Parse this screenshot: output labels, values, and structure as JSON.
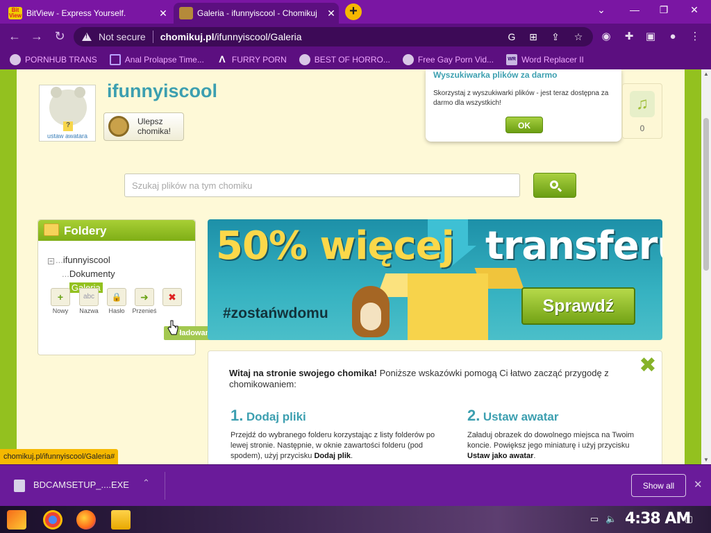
{
  "tabs": [
    {
      "title": "BitView - Express Yourself.",
      "favicon": "bitview-icon",
      "favicon_text": "Bit View",
      "active": false
    },
    {
      "title": "Galeria - ifunnyiscool - Chomikuj",
      "favicon": "chomikuj-icon",
      "favicon_text": "",
      "active": true
    }
  ],
  "new_tab_label": "+",
  "window_controls": {
    "minimize": "⌄",
    "restore": "❐",
    "close": "✕",
    "min2": "—"
  },
  "omnibox": {
    "security": "Not secure",
    "host": "chomikuj.pl",
    "path": "/ifunnyiscool/Galeria"
  },
  "bookmarks": [
    {
      "label": "PORNHUB TRANS",
      "icon": "globe-icon"
    },
    {
      "label": "Anal Prolapse Time...",
      "icon": "bracket-icon"
    },
    {
      "label": "FURRY PORN",
      "icon": "lambda-icon"
    },
    {
      "label": "BEST OF HORRO...",
      "icon": "globe-icon"
    },
    {
      "label": "Free Gay Porn Vid...",
      "icon": "bear-icon"
    },
    {
      "label": "Word Replacer II",
      "icon": "word-replacer-icon"
    }
  ],
  "profile": {
    "username": "ifunnyiscool",
    "set_avatar": "ustaw awatara",
    "upgrade_label_line1": "Ulepsz",
    "upgrade_label_line2": "chomika!",
    "music_count": "0"
  },
  "popup": {
    "title": "Wyszukiwarka plików za darmo",
    "body": "Skorzystaj z wyszukiwarki plików - jest teraz dostępna za darmo dla wszystkich!",
    "ok": "OK"
  },
  "search": {
    "placeholder": "Szukaj plików na tym chomiku"
  },
  "folders": {
    "title": "Foldery",
    "minus": "−",
    "root": "ifunnyiscool",
    "dots": "...",
    "children": [
      "Dokumenty",
      "Galeria"
    ],
    "tools": [
      {
        "label": "Nowy",
        "glyph": "+",
        "color": "#6aa317"
      },
      {
        "label": "Nazwa",
        "glyph": "abc",
        "color": "#9aa"
      },
      {
        "label": "Hasło",
        "glyph": "🔒",
        "color": "#a9a27a"
      },
      {
        "label": "Przenieś",
        "glyph": "➜",
        "color": "#6aa317"
      },
      {
        "label": "",
        "glyph": "✖",
        "color": "#d22"
      }
    ],
    "loading": "ładowanie..."
  },
  "banner": {
    "headline_left": "50% więcej",
    "headline_right": "transferu!",
    "hashtag": "#zostańwdomu",
    "cta": "Sprawdź"
  },
  "welcome": {
    "intro_bold": "Witaj na stronie swojego chomika!",
    "intro_rest": " Poniższe wskazówki pomogą Ci łatwo zacząć przygodę z chomikowaniem:",
    "close_glyph": "✖",
    "steps": [
      {
        "num": "1.",
        "title": "Dodaj pliki",
        "body_pre": "Przejdź do wybranego folderu korzystając z listy folderów po lewej stronie. Następnie, w oknie zawartości folderu (pod spodem), użyj przycisku ",
        "body_bold": "Dodaj plik",
        "body_post": "."
      },
      {
        "num": "2.",
        "title": "Ustaw awatar",
        "body_pre": "Załaduj obrazek do dowolnego miejsca na Twoim koncie. Powiększ jego miniaturę i użyj przycisku ",
        "body_bold": "Ustaw jako awatar",
        "body_post": "."
      }
    ]
  },
  "status_url": "chomikuj.pl/ifunnyiscool/Galeria#",
  "download": {
    "filename": "BDCAMSETUP_....EXE",
    "caret": "⌃",
    "show_all": "Show all",
    "close": "✕"
  },
  "taskbar": {
    "clock": "4:38 AM"
  },
  "colors": {
    "brand_green": "#93c11f",
    "teal": "#3c9fb0",
    "chrome_purple": "#5c0f80"
  }
}
